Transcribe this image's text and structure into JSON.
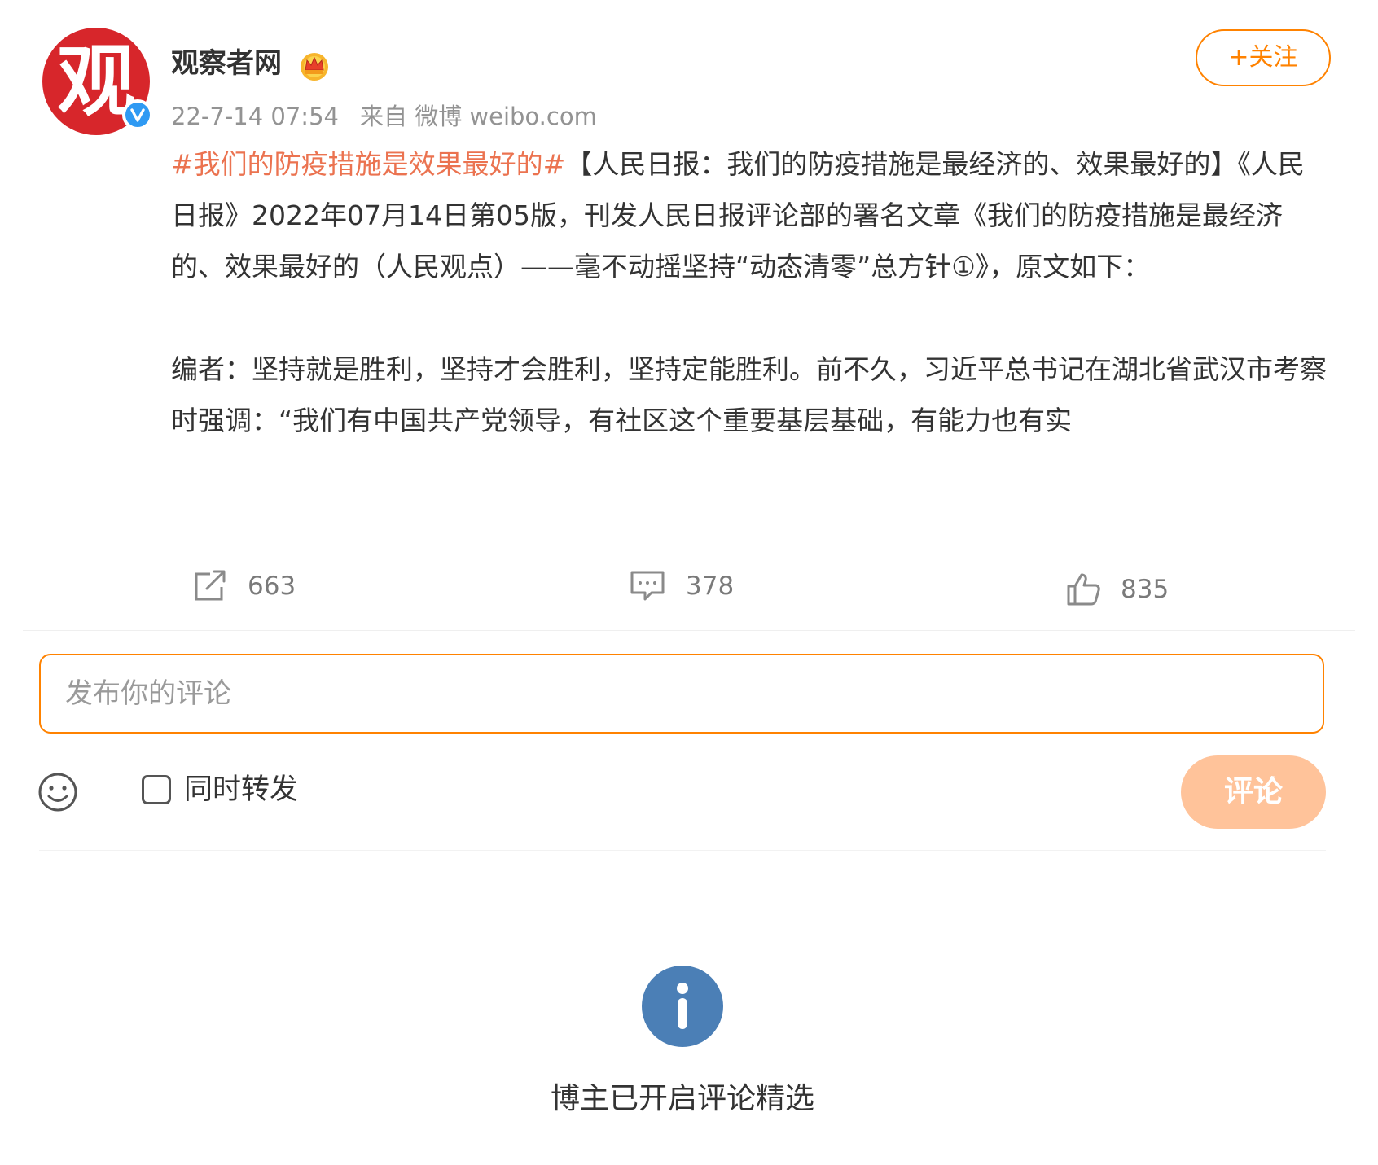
{
  "user": {
    "name": "观察者网",
    "avatar_glyph": "观",
    "timestamp": "22-7-14 07:54",
    "source": "来自 微博 weibo.com",
    "follow_label": "+关注"
  },
  "post": {
    "hashtag": "#我们的防疫措施是效果最好的#",
    "paragraph1": "【人民日报：我们的防疫措施是最经济的、效果最好的】《人民日报》2022年07月14日第05版，刊发人民日报评论部的署名文章《我们的防疫措施是最经济的、效果最好的（人民观点）——毫不动摇坚持“动态清零”总方针①》，原文如下：",
    "paragraph2": "编者：坚持就是胜利，坚持才会胜利，坚持定能胜利。前不久，习近平总书记在湖北省武汉市考察时强调：“我们有中国共产党领导，有社区这个重要基层基础，有能力也有实"
  },
  "actions": {
    "repost_count": "663",
    "comment_count": "378",
    "like_count": "835"
  },
  "composer": {
    "placeholder": "发布你的评论",
    "repost_label": "同时转发",
    "submit_label": "评论"
  },
  "notice": {
    "text": "博主已开启评论精选"
  },
  "colors": {
    "accent": "#ff8200",
    "hashtag": "#eb7350",
    "submit_disabled": "#ffc39a",
    "info": "#4b7fb6",
    "avatar_bg": "#d7262b",
    "verified": "#2f9af3"
  }
}
